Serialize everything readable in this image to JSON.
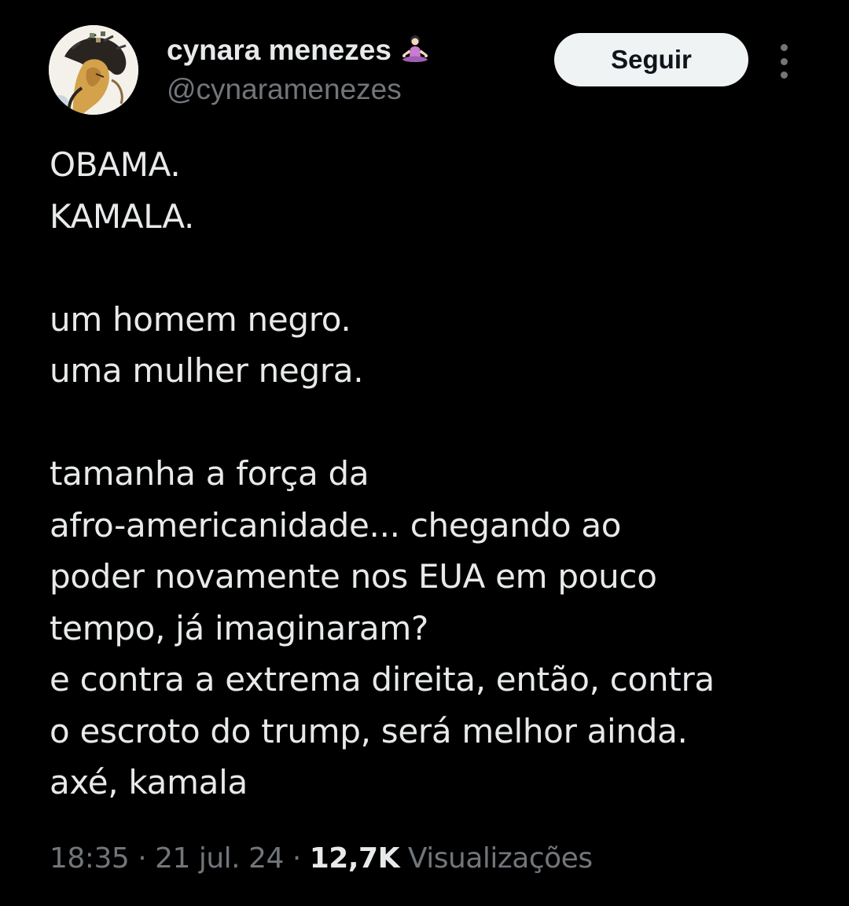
{
  "author": {
    "display_name": "cynara menezes",
    "badge_emoji": "🧘🏻‍♀️",
    "handle": "@cynaramenezes",
    "avatar_icon": "avatar-illustration"
  },
  "actions": {
    "follow_label": "Seguir",
    "more_icon": "more-vertical-icon"
  },
  "tweet": {
    "lines": [
      "OBAMA.",
      "KAMALA.",
      "",
      "um homem negro.",
      "uma mulher negra.",
      "",
      "tamanha a força da",
      "afro-americanidade... chegando ao",
      "poder novamente nos EUA em pouco",
      "tempo, já imaginaram?",
      "e contra a extrema direita, então, contra",
      "o escroto do trump, será melhor ainda.",
      "axé, kamala"
    ]
  },
  "meta": {
    "time": "18:35",
    "separator": "·",
    "date": "21 jul. 24",
    "views_count": "12,7K",
    "views_label": "Visualizações"
  },
  "colors": {
    "background": "#000000",
    "text_primary": "#e7e9ea",
    "text_secondary": "#71767b",
    "follow_bg": "#eff3f4",
    "follow_text": "#0f1419"
  }
}
